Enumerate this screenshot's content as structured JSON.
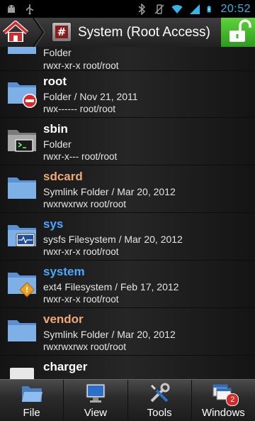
{
  "status_bar": {
    "time": "20:52",
    "icons": [
      "android-debug-icon",
      "usb-icon",
      "bluetooth-icon",
      "vibrate-icon",
      "wifi-icon",
      "signal-icon",
      "battery-icon"
    ]
  },
  "header": {
    "title": "System (Root Access)",
    "hash_symbol": "#"
  },
  "list": {
    "items": [
      {
        "name": "",
        "info": "Folder",
        "perm": "rwxr-xr-x root/root",
        "icon": "folder-icon",
        "name_color": "#ffffff"
      },
      {
        "name": "root",
        "info": "Folder / Nov 21, 2011",
        "perm": "rwx------ root/root",
        "icon": "folder-restricted-icon",
        "name_color": "#ffffff"
      },
      {
        "name": "sbin",
        "info": "Folder",
        "perm": "rwxr-x--- root/root",
        "icon": "folder-terminal-icon",
        "name_color": "#ffffff"
      },
      {
        "name": "sdcard",
        "info": "Symlink Folder / Mar 20, 2012",
        "perm": "rwxrwxrwx root/root",
        "icon": "folder-icon",
        "name_color": "#f0a878"
      },
      {
        "name": "sys",
        "info": "sysfs Filesystem / Mar 20, 2012",
        "perm": "rwxr-xr-x root/root",
        "icon": "folder-monitor-icon",
        "name_color": "#4aa8ff"
      },
      {
        "name": "system",
        "info": "ext4 Filesystem / Feb 17, 2012",
        "perm": "rwxr-xr-x root/root",
        "icon": "folder-warning-icon",
        "name_color": "#4aa8ff"
      },
      {
        "name": "vendor",
        "info": "Symlink Folder / Mar 20, 2012",
        "perm": "rwxrwxrwx root/root",
        "icon": "folder-icon",
        "name_color": "#f0a878"
      },
      {
        "name": "charger",
        "info": "",
        "perm": "",
        "icon": "file-icon",
        "name_color": "#ffffff"
      }
    ]
  },
  "toolbar": {
    "file_label": "File",
    "view_label": "View",
    "tools_label": "Tools",
    "windows_label": "Windows",
    "windows_badge": "2"
  },
  "colors": {
    "accent_blue": "#33b5e5",
    "lock_green": "#3fbf2a",
    "folder_blue": "#6fa0d8"
  }
}
